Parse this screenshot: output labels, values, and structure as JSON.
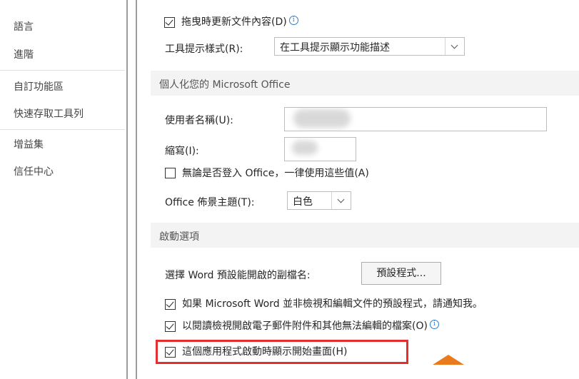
{
  "sidebar": {
    "items": [
      {
        "label": "語言"
      },
      {
        "label": "進階"
      },
      {
        "label": "自訂功能區"
      },
      {
        "label": "快速存取工具列"
      },
      {
        "label": "增益集"
      },
      {
        "label": "信任中心"
      }
    ]
  },
  "options": {
    "drag_update_label": "拖曳時更新文件內容(D)",
    "drag_update_checked": true,
    "tooltip_style_label": "工具提示樣式(R):",
    "tooltip_style_value": "在工具提示顯示功能描述",
    "info_glyph": "i"
  },
  "personalize": {
    "header": "個人化您的 Microsoft Office",
    "username_label": "使用者名稱(U):",
    "initials_label": "縮寫(I):",
    "always_use_label": "無論是否登入 Office，一律使用這些值(A)",
    "always_use_checked": false,
    "theme_label": "Office 佈景主題(T):",
    "theme_value": "白色"
  },
  "startup": {
    "header": "啟動選項",
    "default_ext_label": "選擇 Word 預設能開啟的副檔名:",
    "default_programs_button": "預設程式...",
    "notify_label": "如果 Microsoft Word 並非檢視和編輯文件的預設程式，請通知我。",
    "notify_checked": true,
    "reading_view_label": "以閱讀檢視開啟電子郵件附件和其他無法編輯的檔案(O)",
    "reading_view_checked": true,
    "start_screen_label": "這個應用程式啟動時顯示開始畫面(H)",
    "start_screen_checked": true
  },
  "colors": {
    "highlight": "#e52e2e",
    "info_accent": "#2b7cd3",
    "section_bg": "#f3f3f3"
  }
}
